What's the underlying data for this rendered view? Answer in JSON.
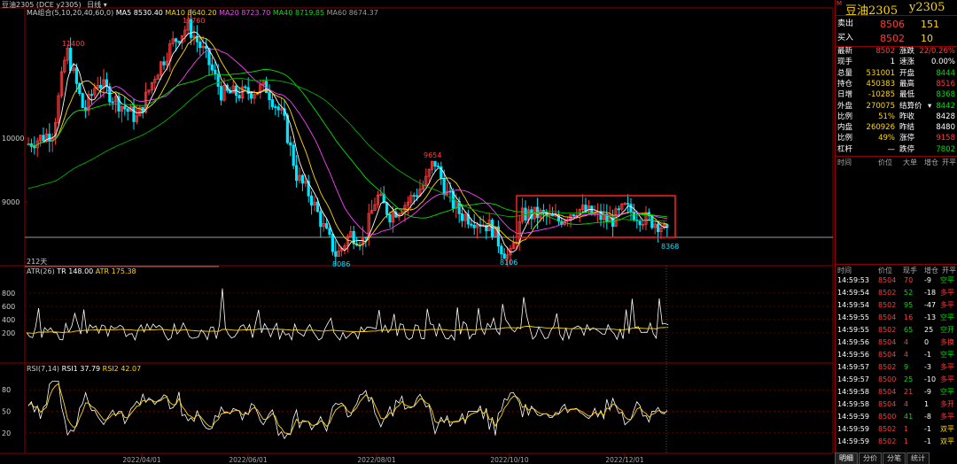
{
  "header": {
    "symbol_label": "豆油2305",
    "code_label": "(DCE y2305)",
    "period": "日线",
    "dropdown_glyph": "▾"
  },
  "ma_legend": {
    "name": "MA组合(5,10,20,40,60,0)",
    "items": [
      {
        "label": "MA5 8530.40",
        "color": "#ffffff"
      },
      {
        "label": "MA10 8640.20",
        "color": "#ffd700"
      },
      {
        "label": "MA20 8723.70",
        "color": "#ff40ff"
      },
      {
        "label": "MA40 8719.85",
        "color": "#00e000"
      },
      {
        "label": "MA60 8674.37",
        "color": "#9a9a9a"
      }
    ]
  },
  "price_axis": {
    "ticks": [
      {
        "label": "10000",
        "value": 10000
      },
      {
        "label": "9000",
        "value": 9000
      }
    ]
  },
  "annotations": {
    "high1": "11400",
    "high2": "11760",
    "mid_high": "9654",
    "low1": "8086",
    "low2": "8106",
    "last_low": "8368",
    "day_count": "212天"
  },
  "atr_legend": {
    "name": "ATR(26)",
    "items": [
      {
        "label": "TR 148.00",
        "color": "#ffffff"
      },
      {
        "label": "ATR 175.38",
        "color": "#ffd700"
      }
    ]
  },
  "atr_axis": [
    "800",
    "600",
    "400",
    "200"
  ],
  "rsi_legend": {
    "name": "RSI(7,14)",
    "items": [
      {
        "label": "RSI1 37.79",
        "color": "#ffffff"
      },
      {
        "label": "RSI2 42.07",
        "color": "#ffd700"
      }
    ]
  },
  "rsi_axis": [
    "80",
    "50",
    "20"
  ],
  "date_axis": [
    "2022/04/01",
    "2022/06/01",
    "2022/08/01",
    "2022/10/10",
    "2022/12/01"
  ],
  "panel": {
    "title": "豆油2305",
    "code": "y2305",
    "title_marker": "M",
    "sell_label": "卖出",
    "sell_price": "8506",
    "sell_vol": "151",
    "buy_label": "买入",
    "buy_price": "8502",
    "buy_vol": "10",
    "quote_rows": [
      {
        "l1": "最新",
        "v1": "8502",
        "c1": "red",
        "l2": "涨跌",
        "v2": "22/0.26%",
        "c2": "red"
      },
      {
        "l1": "现手",
        "v1": "1",
        "c1": "white",
        "l2": "速涨",
        "v2": "0.00%",
        "c2": "white"
      },
      {
        "l1": "总量",
        "v1": "531001",
        "c1": "yellow",
        "l2": "开盘",
        "v2": "8444",
        "c2": "green"
      },
      {
        "l1": "持仓",
        "v1": "450383",
        "c1": "yellow",
        "l2": "最高",
        "v2": "8516",
        "c2": "red"
      },
      {
        "l1": "日增",
        "v1": "-10285",
        "c1": "yellow",
        "l2": "最低",
        "v2": "8368",
        "c2": "green"
      },
      {
        "l1": "外盘",
        "v1": "270075",
        "c1": "yellow",
        "l2": "结算价",
        "v2": "8442",
        "c2": "green"
      },
      {
        "l1": "比例",
        "v1": "51%",
        "c1": "yellow",
        "l2": "昨收",
        "v2": "8428",
        "c2": "white"
      },
      {
        "l1": "内盘",
        "v1": "260926",
        "c1": "yellow",
        "l2": "昨结",
        "v2": "8480",
        "c2": "white"
      },
      {
        "l1": "比例",
        "v1": "49%",
        "c1": "yellow",
        "l2": "涨停",
        "v2": "9158",
        "c2": "red"
      },
      {
        "l1": "杠杆",
        "v1": "—",
        "c1": "white",
        "l2": "跌停",
        "v2": "7802",
        "c2": "green"
      }
    ],
    "settle_dropdown": "▾",
    "cols1": [
      "时间",
      "价位",
      "大单",
      "增仓",
      "开平"
    ],
    "cols2": [
      "时间",
      "价位",
      "现手",
      "增仓",
      "开平"
    ],
    "ticks": [
      {
        "t": "14:59:53",
        "p": "8504",
        "v": "70",
        "d": "-9",
        "k": "空平",
        "vc": "red",
        "kc": "green"
      },
      {
        "t": "14:59:54",
        "p": "8502",
        "v": "52",
        "d": "-18",
        "k": "多平",
        "vc": "green",
        "kc": "red"
      },
      {
        "t": "14:59:54",
        "p": "8502",
        "v": "95",
        "d": "-47",
        "k": "多平",
        "vc": "green",
        "kc": "red"
      },
      {
        "t": "14:59:55",
        "p": "8504",
        "v": "16",
        "d": "-13",
        "k": "空平",
        "vc": "red",
        "kc": "green"
      },
      {
        "t": "14:59:55",
        "p": "8502",
        "v": "65",
        "d": "25",
        "k": "空开",
        "vc": "green",
        "kc": "green"
      },
      {
        "t": "14:59:56",
        "p": "8504",
        "v": "4",
        "d": "0",
        "k": "多换",
        "vc": "red",
        "kc": "red"
      },
      {
        "t": "14:59:56",
        "p": "8504",
        "v": "4",
        "d": "-1",
        "k": "空平",
        "vc": "red",
        "kc": "green"
      },
      {
        "t": "14:59:57",
        "p": "8502",
        "v": "9",
        "d": "-3",
        "k": "多平",
        "vc": "green",
        "kc": "red"
      },
      {
        "t": "14:59:57",
        "p": "8500",
        "v": "25",
        "d": "-10",
        "k": "多平",
        "vc": "green",
        "kc": "red"
      },
      {
        "t": "14:59:58",
        "p": "8504",
        "v": "21",
        "d": "-9",
        "k": "空平",
        "vc": "red",
        "kc": "green"
      },
      {
        "t": "14:59:58",
        "p": "8504",
        "v": "4",
        "d": "1",
        "k": "多开",
        "vc": "red",
        "kc": "red"
      },
      {
        "t": "14:59:59",
        "p": "8500",
        "v": "41",
        "d": "-8",
        "k": "多平",
        "vc": "green",
        "kc": "red"
      },
      {
        "t": "14:59:59",
        "p": "8502",
        "v": "1",
        "d": "-1",
        "k": "双平",
        "vc": "red",
        "kc": "yellow"
      },
      {
        "t": "14:59:59",
        "p": "8502",
        "v": "1",
        "d": "-1",
        "k": "双平",
        "vc": "red",
        "kc": "yellow"
      }
    ],
    "tabs": [
      "明细",
      "分价",
      "分笔",
      "统计"
    ]
  },
  "colors": {
    "up": "#ff3b3b",
    "down": "#00e5ff",
    "frame": "#8b0000",
    "highlight": "#ff2020"
  }
}
